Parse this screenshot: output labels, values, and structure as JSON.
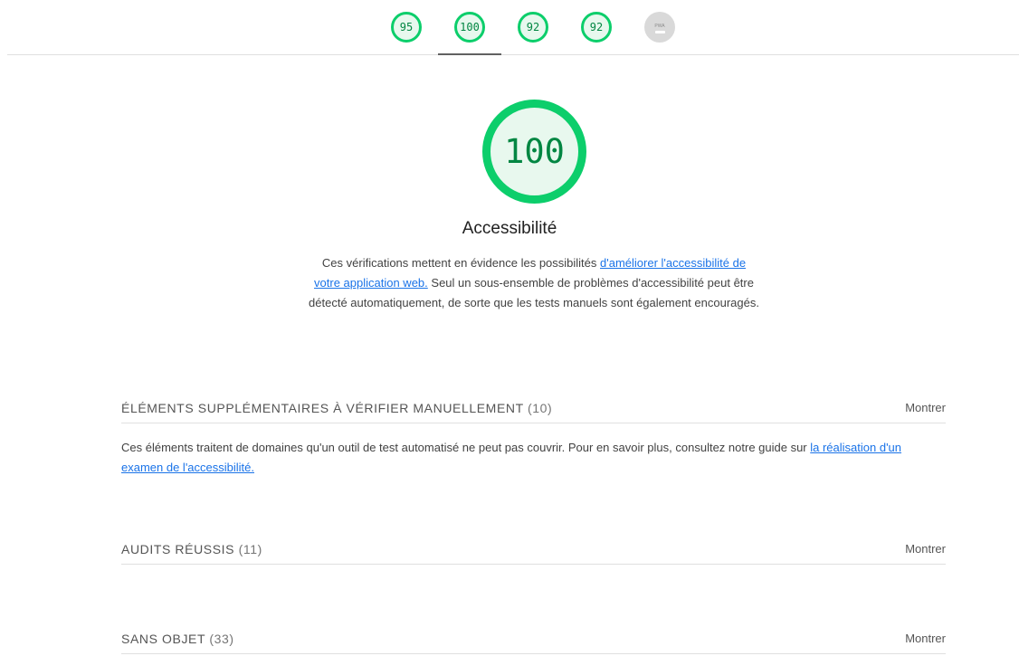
{
  "score_tabs": [
    {
      "value": "95",
      "color": "#0cce6b"
    },
    {
      "value": "100",
      "color": "#0cce6b",
      "active": true
    },
    {
      "value": "92",
      "color": "#0cce6b"
    },
    {
      "value": "92",
      "color": "#0cce6b"
    },
    {
      "value": "",
      "label": "PWA",
      "icon": "dash-icon",
      "color": "#d9d9d9"
    }
  ],
  "category": {
    "score": "100",
    "score_color": "#0cce6b",
    "title": "Accessibilité",
    "desc_before": "Ces vérifications mettent en évidence les possibilités ",
    "desc_link": "d'améliorer l'accessibilité de votre application web.",
    "desc_after": " Seul un sous-ensemble de problèmes d'accessibilité peut être détecté automatiquement, de sorte que les tests manuels sont également encouragés."
  },
  "groups": [
    {
      "title": "ÉLÉMENTS SUPPLÉMENTAIRES À VÉRIFIER MANUELLEMENT",
      "count": "(10)",
      "toggle": "Montrer",
      "desc_before": "Ces éléments traitent de domaines qu'un outil de test automatisé ne peut pas couvrir. Pour en savoir plus, consultez notre guide sur ",
      "desc_link": "la réalisation d'un examen de l'accessibilité."
    },
    {
      "title": "AUDITS RÉUSSIS",
      "count": "(11)",
      "toggle": "Montrer"
    },
    {
      "title": "SANS OBJET",
      "count": "(33)",
      "toggle": "Montrer"
    }
  ],
  "colors": {
    "pass": "#0cce6b",
    "pass_text": "#018642",
    "link": "#1a73e8"
  }
}
